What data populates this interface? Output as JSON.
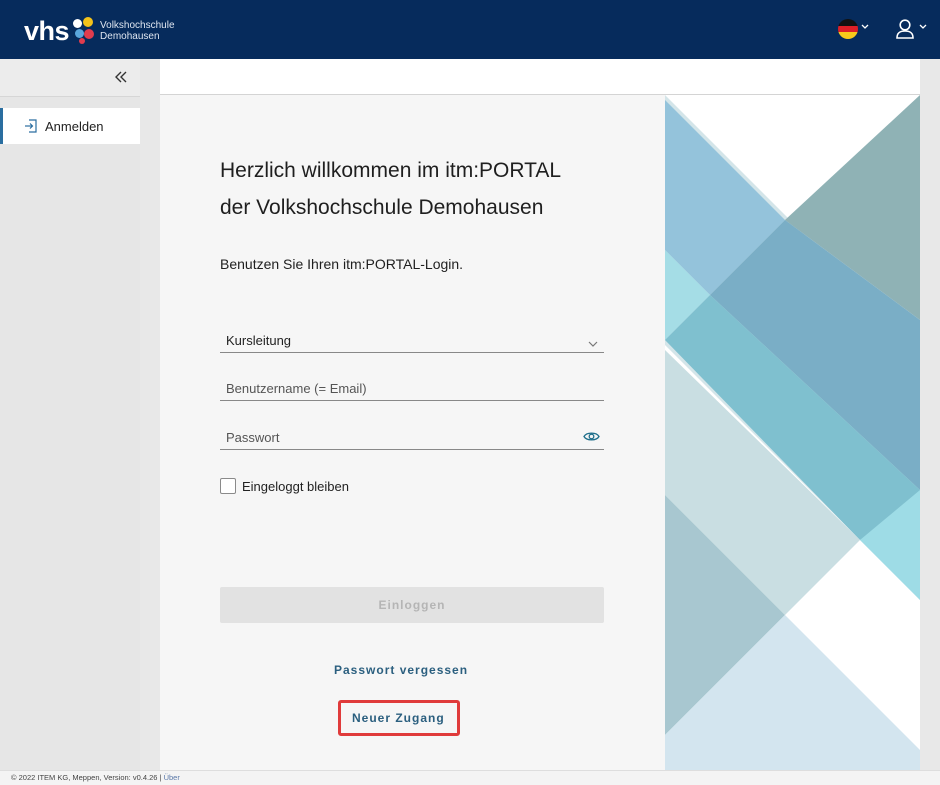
{
  "header": {
    "logo_main": "vhs",
    "logo_line1": "Volkshochschule",
    "logo_line2": "Demohausen",
    "language_icon": "germany-flag-icon",
    "user_icon": "user-icon",
    "brand_color": "#062b5c"
  },
  "sidebar": {
    "collapse_icon": "double-chevron-left-icon",
    "items": [
      {
        "label": "Anmelden",
        "icon": "login-icon"
      }
    ]
  },
  "login": {
    "title_line1": "Herzlich willkommen im itm:PORTAL",
    "title_line2": "der Volkshochschule Demohausen",
    "subtitle": "Benutzen Sie Ihren itm:PORTAL-Login.",
    "role_select": {
      "value": "Kursleitung"
    },
    "username": {
      "placeholder": "Benutzername (= Email)",
      "value": ""
    },
    "password": {
      "placeholder": "Passwort",
      "value": ""
    },
    "remember_label": "Eingeloggt bleiben",
    "remember_checked": false,
    "login_button": "Einloggen",
    "forgot_link": "Passwort vergessen",
    "new_access_link": "Neuer Zugang"
  },
  "footer": {
    "text": "© 2022 ITEM KG, Meppen, Version: v0.4.26 | ",
    "about_link": "Über"
  }
}
